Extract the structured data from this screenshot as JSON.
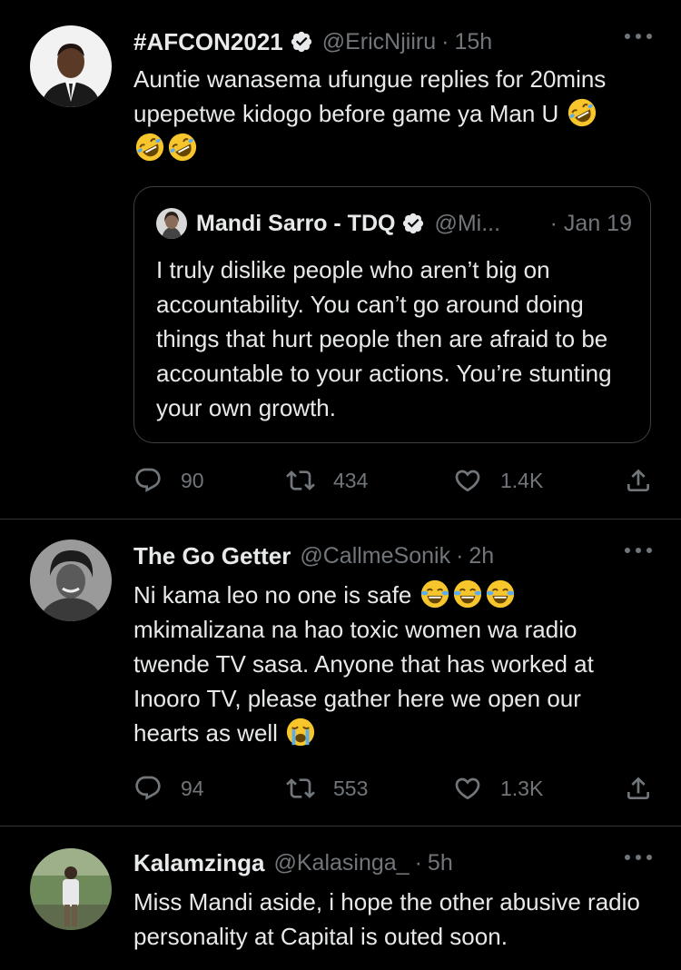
{
  "tweets": [
    {
      "name": "#AFCON2021",
      "verified": true,
      "handle": "@EricNjiiru",
      "time": "15h",
      "text_line1": "Auntie wanasema ufungue replies for 20mins",
      "text_line2": "upepetwe kidogo before game ya Man U",
      "emoji_line1": "rofl-emoji",
      "emoji_line2": [
        "rofl-emoji",
        "rofl-emoji"
      ],
      "quote": {
        "name": "Mandi Sarro - TDQ",
        "verified": true,
        "handle": "@Mi...",
        "time": "· Jan 19",
        "text": "I truly dislike people who aren’t big on accountability. You can’t go around doing things that hurt people then are afraid to be accountable to your actions. You’re stunting your own growth."
      },
      "replies": "90",
      "retweets": "434",
      "likes": "1.4K"
    },
    {
      "name": "The Go Getter",
      "handle": "@CallmeSonik",
      "time": "2h",
      "text_line1": "Ni kama leo no one is safe",
      "emoji_line1": [
        "joy-emoji",
        "joy-emoji",
        "joy-emoji"
      ],
      "text_rest": "mkimalizana na hao toxic women wa radio twende TV sasa. Anyone that has worked at Inooro TV, please gather here we open our",
      "text_last": "hearts as well",
      "emoji_last": "loudly-crying-emoji",
      "replies": "94",
      "retweets": "553",
      "likes": "1.3K"
    },
    {
      "name": "Kalamzinga",
      "handle": "@Kalasinga_",
      "time": "5h",
      "text": "Miss Mandi aside, i hope the other abusive radio personality at Capital is outed soon."
    }
  ],
  "separator": "·",
  "icons": {
    "reply": "reply-icon",
    "retweet": "retweet-icon",
    "like": "heart-icon",
    "share": "share-icon",
    "more": "more-icon",
    "verified": "verified-badge-icon"
  },
  "colors": {
    "background": "#000000",
    "text": "#e7e9ea",
    "secondary": "#71767b",
    "divider": "#2f3336"
  }
}
